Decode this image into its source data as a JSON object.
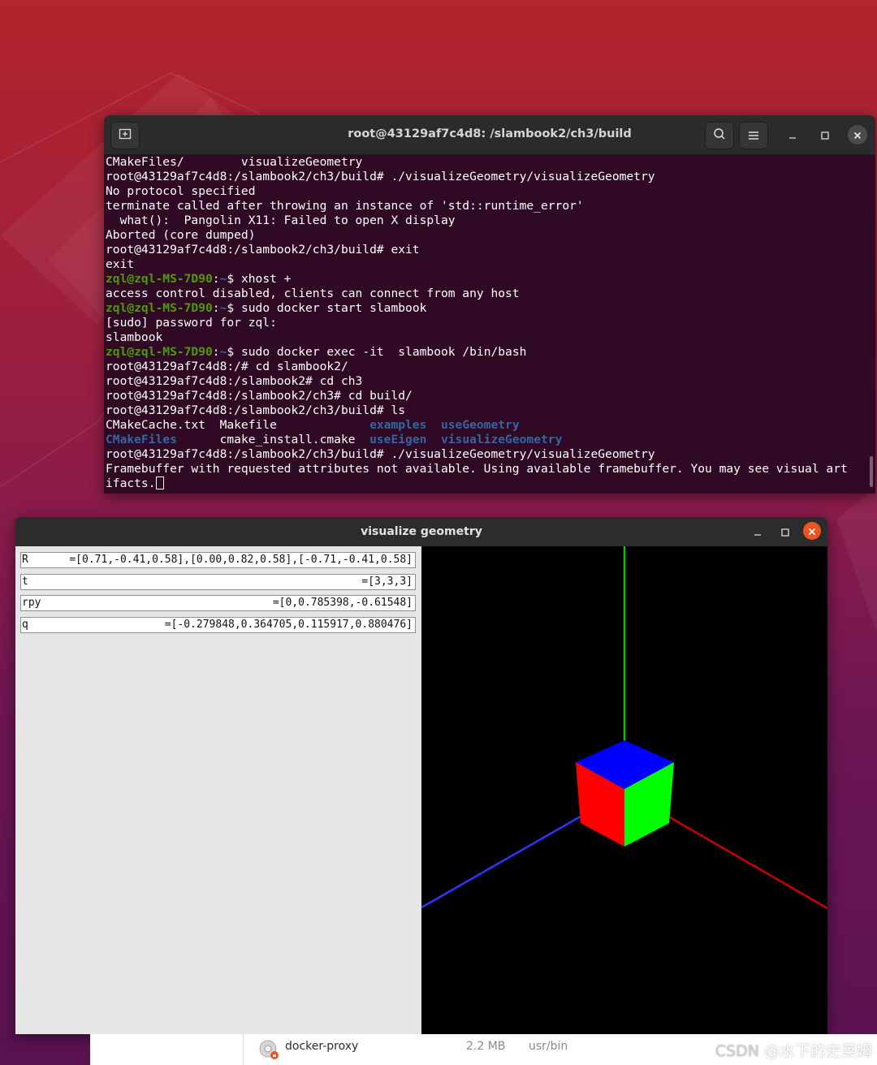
{
  "terminal": {
    "title": "root@43129af7c4d8: /slambook2/ch3/build",
    "lines": [
      [
        {
          "t": "CMakeFiles/        visualizeGeometry"
        }
      ],
      [
        {
          "t": "root@43129af7c4d8:/slambook2/ch3/build# ./visualizeGeometry/visualizeGeometry"
        }
      ],
      [
        {
          "t": "No protocol specified"
        }
      ],
      [
        {
          "t": "terminate called after throwing an instance of 'std::runtime_error'"
        }
      ],
      [
        {
          "t": "  what():  Pangolin X11: Failed to open X display"
        }
      ],
      [
        {
          "t": "Aborted (core dumped)"
        }
      ],
      [
        {
          "t": "root@43129af7c4d8:/slambook2/ch3/build# exit"
        }
      ],
      [
        {
          "t": "exit"
        }
      ],
      [
        {
          "t": "zql@zql-MS-7D90",
          "c": "green"
        },
        {
          "t": ":"
        },
        {
          "t": "~",
          "c": "blue"
        },
        {
          "t": "$ xhost +"
        }
      ],
      [
        {
          "t": "access control disabled, clients can connect from any host"
        }
      ],
      [
        {
          "t": "zql@zql-MS-7D90",
          "c": "green"
        },
        {
          "t": ":"
        },
        {
          "t": "~",
          "c": "blue"
        },
        {
          "t": "$ sudo docker start slambook"
        }
      ],
      [
        {
          "t": "[sudo] password for zql:"
        }
      ],
      [
        {
          "t": "slambook"
        }
      ],
      [
        {
          "t": "zql@zql-MS-7D90",
          "c": "green"
        },
        {
          "t": ":"
        },
        {
          "t": "~",
          "c": "blue"
        },
        {
          "t": "$ sudo docker exec -it  slambook /bin/bash"
        }
      ],
      [
        {
          "t": "root@43129af7c4d8:/# cd slambook2/"
        }
      ],
      [
        {
          "t": "root@43129af7c4d8:/slambook2# cd ch3"
        }
      ],
      [
        {
          "t": "root@43129af7c4d8:/slambook2/ch3# cd build/"
        }
      ],
      [
        {
          "t": "root@43129af7c4d8:/slambook2/ch3/build# ls"
        }
      ],
      [
        {
          "t": "CMakeCache.txt  Makefile             "
        },
        {
          "t": "examples",
          "c": "blue"
        },
        {
          "t": "  "
        },
        {
          "t": "useGeometry",
          "c": "blue"
        }
      ],
      [
        {
          "t": "CMakeFiles",
          "c": "blue"
        },
        {
          "t": "      cmake_install.cmake  "
        },
        {
          "t": "useEigen",
          "c": "blue"
        },
        {
          "t": "  "
        },
        {
          "t": "visualizeGeometry",
          "c": "blue"
        }
      ],
      [
        {
          "t": "root@43129af7c4d8:/slambook2/ch3/build# ./visualizeGeometry/visualizeGeometry"
        }
      ],
      [
        {
          "t": "Framebuffer with requested attributes not available. Using available framebuffer. You may see visual art"
        }
      ],
      [
        {
          "t": "ifacts."
        },
        {
          "cursor": true
        }
      ]
    ]
  },
  "viz": {
    "title": "visualize geometry",
    "fields": [
      {
        "label": "R",
        "value": "=[0.71,-0.41,0.58],[0.00,0.82,0.58],[-0.71,-0.41,0.58]"
      },
      {
        "label": "t",
        "value": "=[3,3,3]"
      },
      {
        "label": "rpy",
        "value": "=[0,0.785398,-0.61548]"
      },
      {
        "label": "q",
        "value": "=[-0.279848,0.364705,0.115917,0.880476]"
      }
    ],
    "colors": {
      "x_axis": "#cc0000",
      "y_axis": "#00cc00",
      "z_axis": "#3333ff",
      "cube_top": "#0000ff",
      "cube_left": "#ff0000",
      "cube_right": "#00ff00"
    }
  },
  "taskbar": {
    "app_name": "docker-proxy",
    "size": "2.2 MB",
    "path": "usr/bin"
  },
  "watermark": {
    "csdn": "CSDN",
    "author": " @水下的史莱姆"
  },
  "icons": [
    "new-tab-icon",
    "search-icon",
    "hamburger-menu-icon",
    "minimize-icon",
    "maximize-icon",
    "close-icon",
    "app-icon"
  ]
}
